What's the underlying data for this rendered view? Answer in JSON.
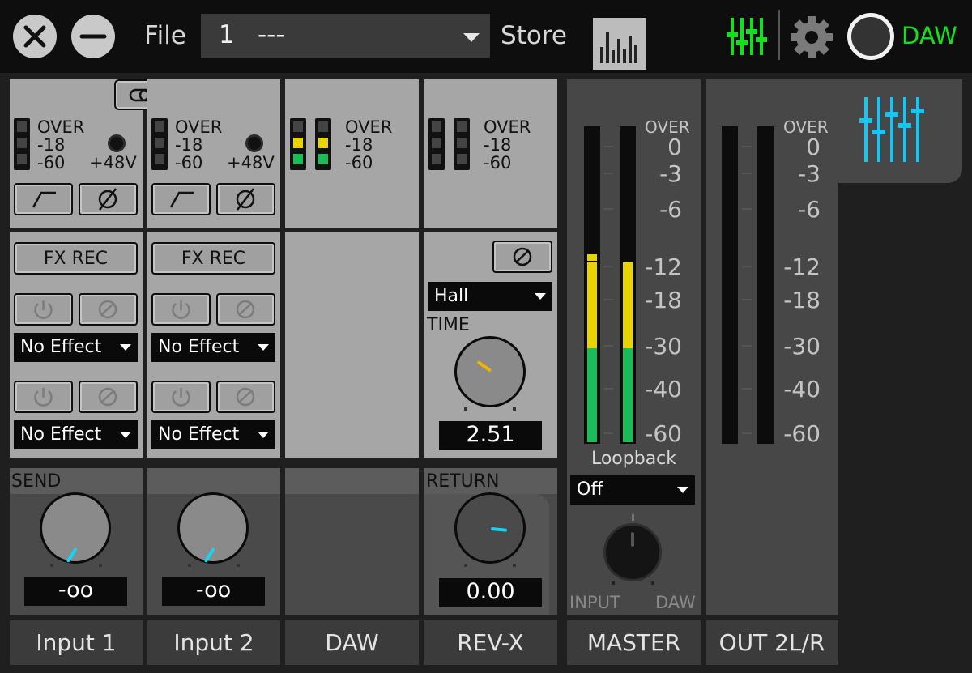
{
  "topbar": {
    "close_icon": "close-icon",
    "minimize_icon": "minimize-icon",
    "file_label": "File",
    "file_number": "1",
    "file_name": "---",
    "store_label": "Store",
    "meter_view_icon": "meter-bars-icon",
    "mixer_icon": "mixer-faders-icon",
    "settings_icon": "gear-icon",
    "daw_label": "DAW",
    "accent_green": "#14e01e"
  },
  "meter_labels": {
    "over": "OVER",
    "m18": "-18",
    "m60": "-60",
    "phantom": "+48V"
  },
  "channels": {
    "input1": {
      "label": "Input 1",
      "fx_rec": "FX REC",
      "effect1": "No Effect",
      "effect2": "No Effect",
      "send_value": "-oo",
      "send_level": 0.0
    },
    "input2": {
      "label": "Input 2",
      "fx_rec": "FX REC",
      "effect1": "No Effect",
      "effect2": "No Effect",
      "send_value": "-oo",
      "send_level": 0.0
    },
    "daw": {
      "label": "DAW",
      "meter_colors": [
        "#e7d400",
        "#1bbd5a"
      ]
    },
    "revx": {
      "label": "REV-X",
      "type": "Hall",
      "time_label": "TIME",
      "time_value": "2.51",
      "return_label": "RETURN",
      "return_value": "0.00"
    },
    "master": {
      "label": "MASTER",
      "loopback_label": "Loopback",
      "loopback_value": "Off",
      "input_label": "INPUT",
      "daw_label": "DAW",
      "meter_level_db": -12
    },
    "out2": {
      "label": "OUT 2L/R",
      "tab_icon": "mixer-faders-icon",
      "accent_blue": "#18c4f0"
    }
  },
  "send_label": "SEND",
  "scale": {
    "over": "OVER",
    "values": [
      "0",
      "-3",
      "-6",
      "-12",
      "-18",
      "-30",
      "-40",
      "-60"
    ]
  }
}
